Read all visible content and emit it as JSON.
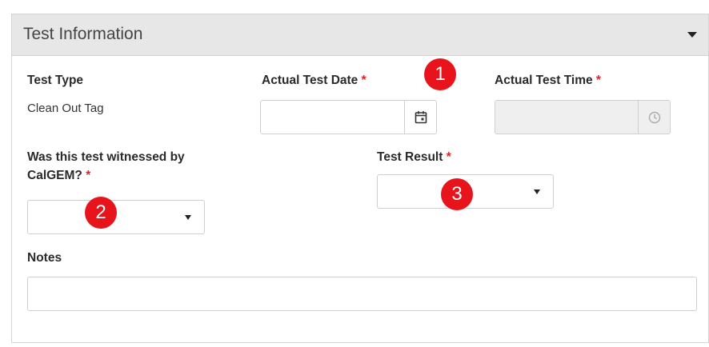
{
  "panel": {
    "title": "Test Information"
  },
  "fields": {
    "test_type": {
      "label": "Test Type",
      "value": "Clean Out Tag"
    },
    "actual_test_date": {
      "label": "Actual Test Date",
      "required_marker": "*",
      "value": "",
      "icon": "calendar-icon"
    },
    "actual_test_time": {
      "label": "Actual Test Time",
      "required_marker": "*",
      "value": "",
      "disabled": true,
      "icon": "clock-icon"
    },
    "witnessed": {
      "label_line1": "Was this test witnessed by",
      "label_line2": "CalGEM?",
      "required_marker": "*",
      "selected": ""
    },
    "test_result": {
      "label": "Test Result",
      "required_marker": "*",
      "selected": ""
    },
    "notes": {
      "label": "Notes",
      "value": ""
    }
  },
  "badges": [
    "1",
    "2",
    "3"
  ],
  "colors": {
    "badge": "#e8141b",
    "required": "#d9272e",
    "header_bg": "#e7e7e7"
  }
}
